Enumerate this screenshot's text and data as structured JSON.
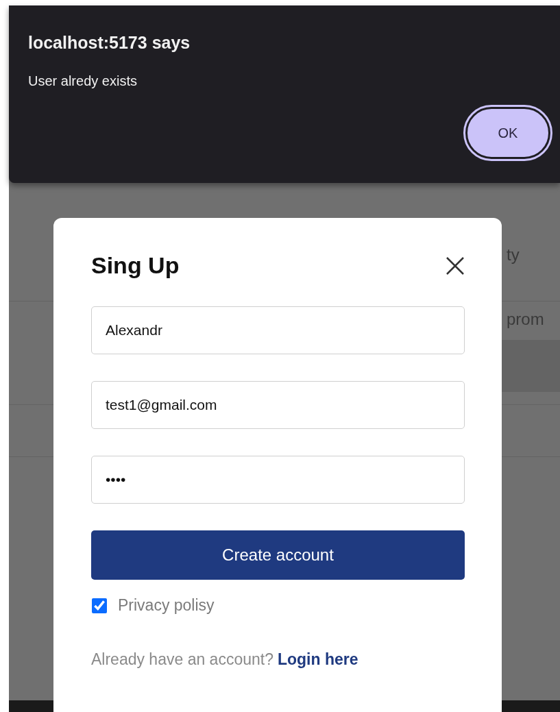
{
  "alert": {
    "title": "localhost:5173 says",
    "message": "User alredy exists",
    "button": "OK"
  },
  "background": {
    "texts": [
      "ty",
      "prom"
    ]
  },
  "modal": {
    "title": "Sing Up",
    "fields": [
      {
        "value": "Alexandr"
      },
      {
        "value": "test1@gmail.com"
      },
      {
        "value": "••••"
      }
    ],
    "submit": "Create account",
    "privacy": {
      "label": "Privacy polisy",
      "checked": true
    },
    "footer": {
      "text": "Already have an account?",
      "link": "Login here"
    }
  }
}
